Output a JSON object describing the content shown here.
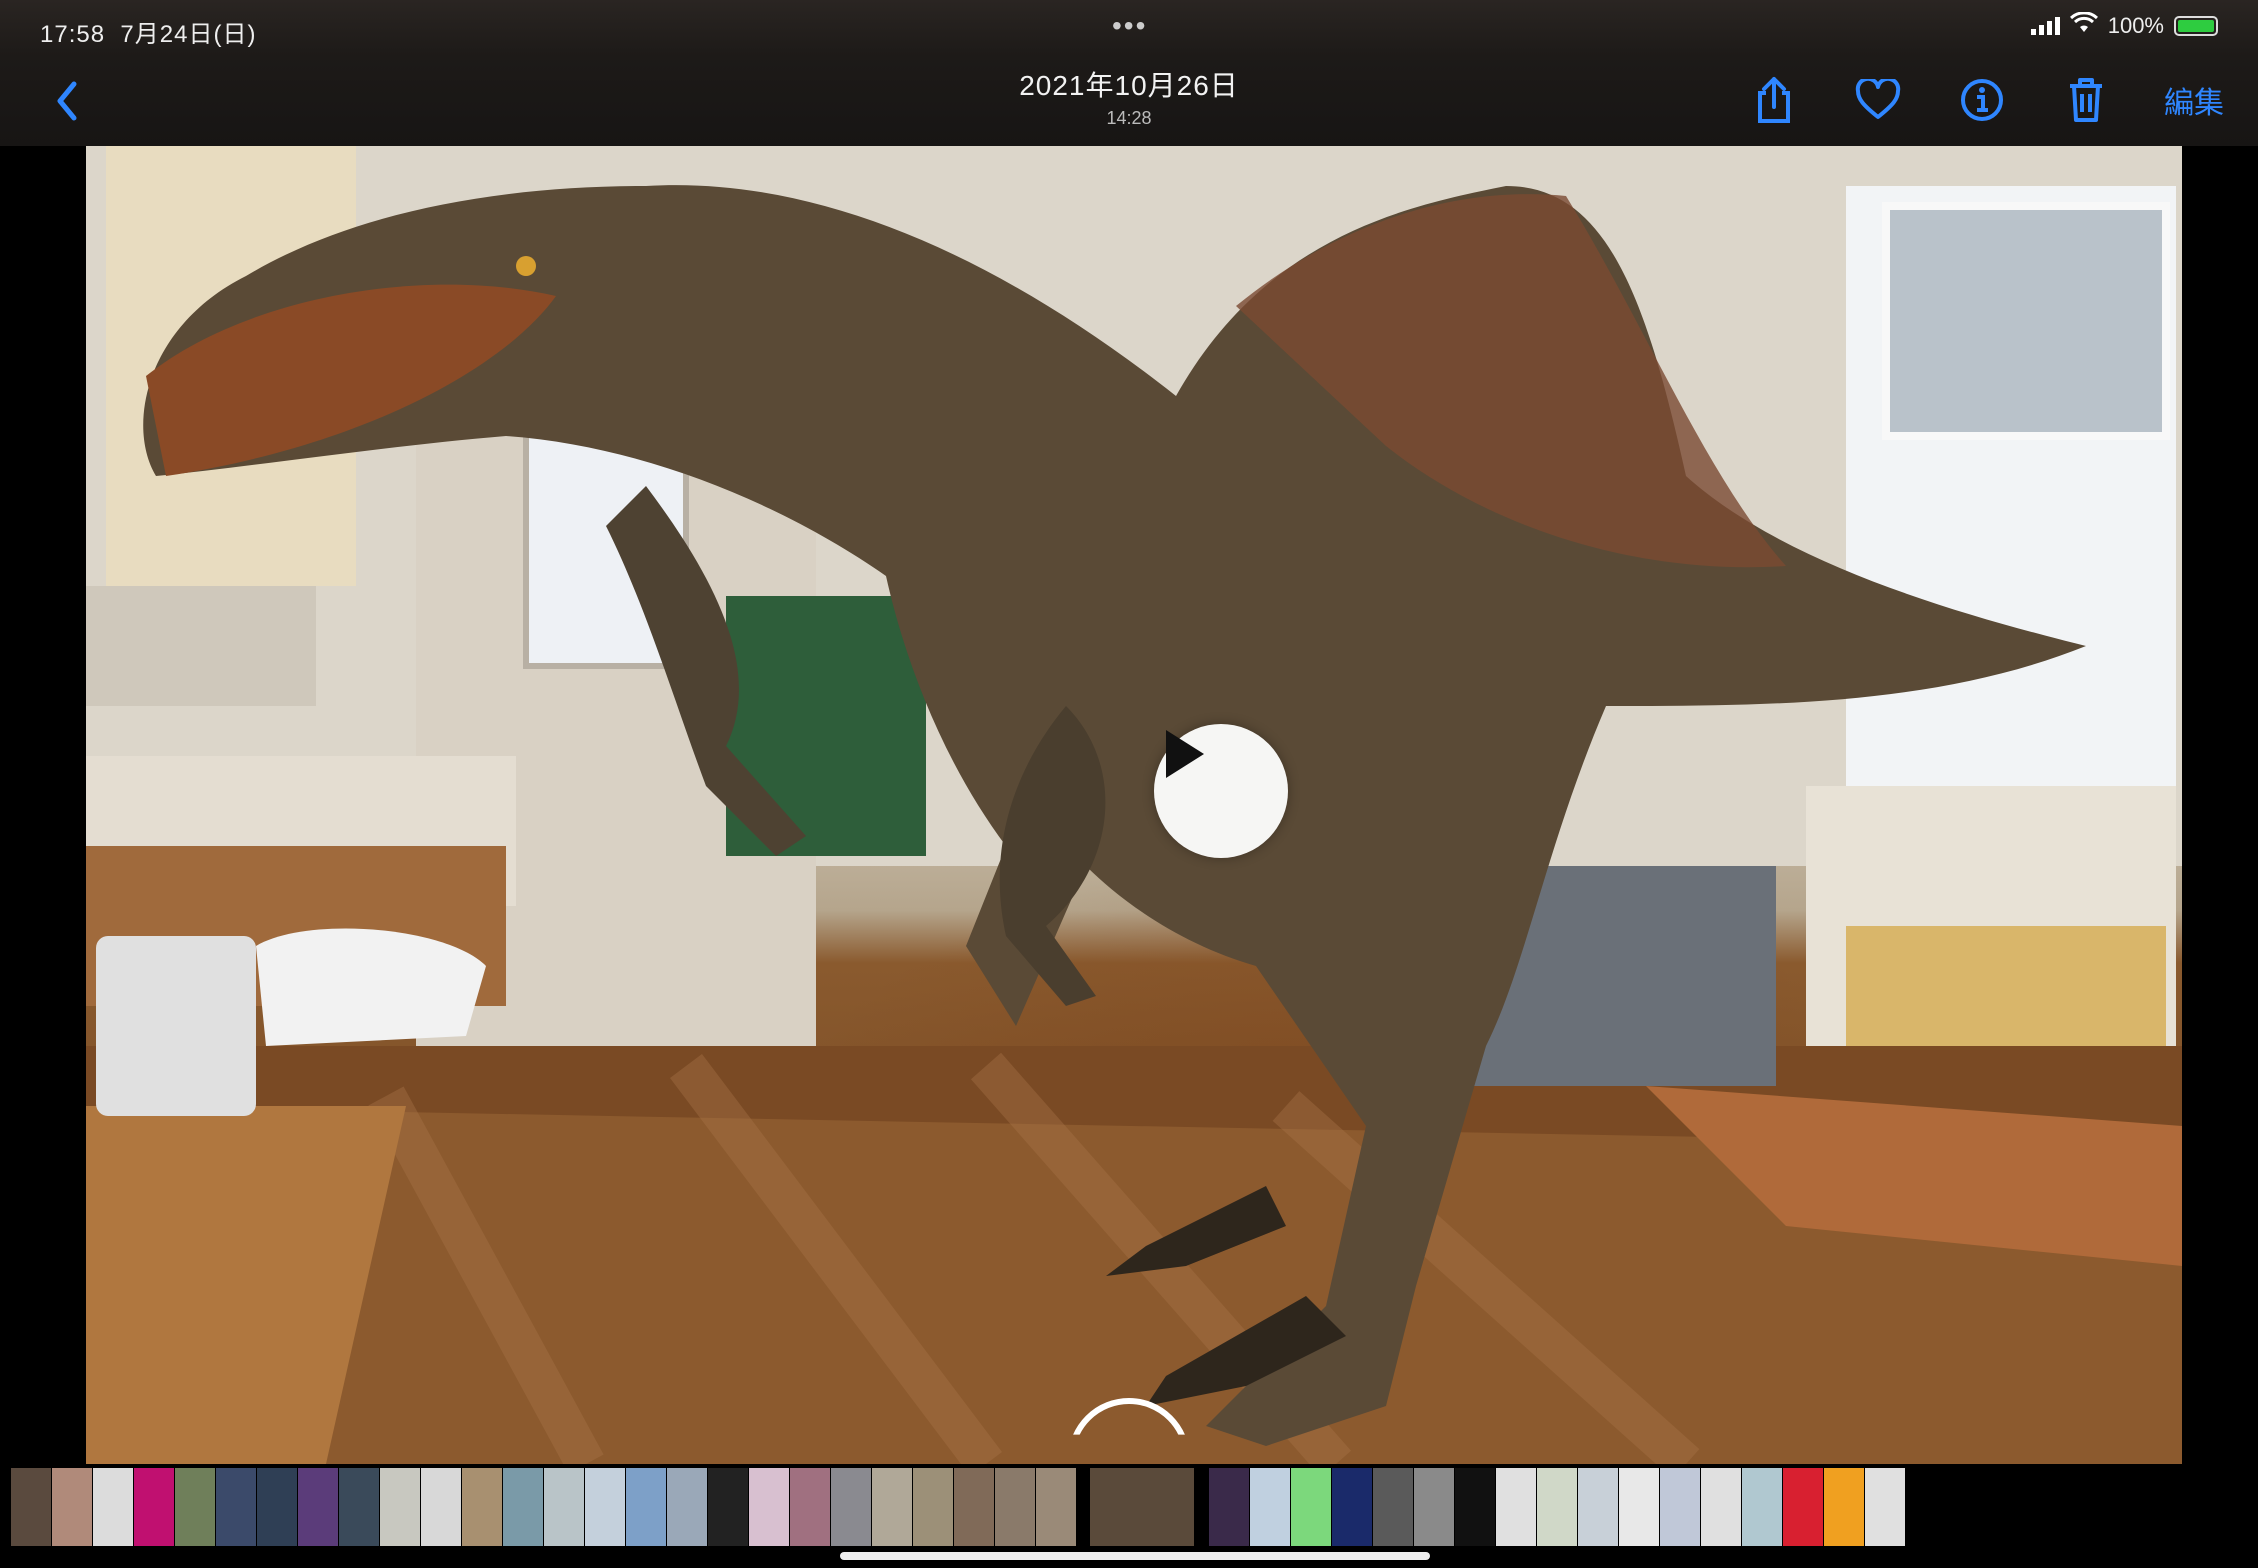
{
  "status_bar": {
    "time": "17:58",
    "date": "7月24日(日)",
    "multitask_dots": "•••",
    "battery_percent": "100%",
    "battery_level": 1.0,
    "charging": true
  },
  "nav": {
    "date": "2021年10月26日",
    "time": "14:28",
    "edit_label": "編集",
    "accent_color": "#2f86ff"
  },
  "icons": {
    "back": "chevron-left-icon",
    "share": "share-icon",
    "favorite": "heart-icon",
    "info": "info-icon",
    "delete": "trash-icon",
    "play": "play-icon"
  },
  "filmstrip": {
    "current_index": 26,
    "thumbnails": [
      "#5a4a3e",
      "#b08a7a",
      "#dcdcdc",
      "#c01070",
      "#6f7f5a",
      "#3b4a6a",
      "#2f3f55",
      "#5b3c7a",
      "#3a4a5a",
      "#c8c8c0",
      "#d8d8d8",
      "#a89070",
      "#7a9aa8",
      "#b9c4c8",
      "#c4d0dc",
      "#7da0c8",
      "#9aa8b8",
      "#222",
      "#d8c0d0",
      "#a07080",
      "#8a8a90",
      "#b0a898",
      "#9c9078",
      "#806a58",
      "#8a7a6a",
      "#9a8a78",
      "#5a4a3a",
      "#3a2a4a",
      "#c0d0e0",
      "#7cd87c",
      "#1a2a6a",
      "#5a5a5a",
      "#8a8a8a",
      "#111",
      "#e0e0e0",
      "#d0d8c8",
      "#c8d0d8",
      "#e8e8e8",
      "#c0c8d8",
      "#e0e0e0",
      "#b0c8d0",
      "#d82030",
      "#f0a020",
      "#e0e0e0"
    ]
  }
}
